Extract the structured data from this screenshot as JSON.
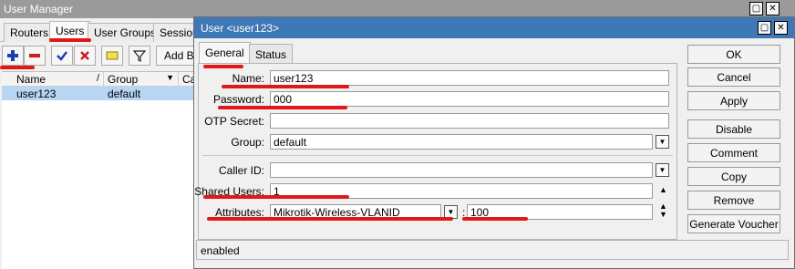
{
  "background_window": {
    "title": "User Manager",
    "tabs": [
      "Routers",
      "Users",
      "User Groups",
      "Sessions"
    ],
    "active_tab": "Users",
    "toolbar": {
      "add_button_label": "Add Ba"
    },
    "table": {
      "columns": [
        "Name",
        "Group",
        "Cal"
      ],
      "rows": [
        {
          "name": "user123",
          "group": "default"
        }
      ]
    }
  },
  "dialog": {
    "title": "User <user123>",
    "tabs": [
      "General",
      "Status"
    ],
    "active_tab": "General",
    "fields": {
      "name": {
        "label": "Name:",
        "value": "user123"
      },
      "password": {
        "label": "Password:",
        "value": "000"
      },
      "otp_secret": {
        "label": "OTP Secret:",
        "value": ""
      },
      "group": {
        "label": "Group:",
        "value": "default"
      },
      "caller_id": {
        "label": "Caller ID:",
        "value": ""
      },
      "shared_users": {
        "label": "Shared Users:",
        "value": "1"
      },
      "attributes": {
        "label": "Attributes:",
        "value": "Mikrotik-Wireless-VLANID",
        "separator": ":",
        "extra_value": "100"
      }
    },
    "buttons": {
      "ok": "OK",
      "cancel": "Cancel",
      "apply": "Apply",
      "disable": "Disable",
      "comment": "Comment",
      "copy": "Copy",
      "remove": "Remove",
      "generate_voucher": "Generate Voucher"
    },
    "status": "enabled"
  },
  "colors": {
    "dialog_titlebar": "#3e78b7",
    "selected_row": "#b7d6f3",
    "annotation_red": "#e01818",
    "add_icon": "#1f3fa8",
    "remove_icon": "#c81e1e",
    "check_icon": "#1f3fa8"
  },
  "icons": [
    "add-icon",
    "remove-icon",
    "check-icon",
    "cross-icon",
    "comment-icon",
    "filter-icon",
    "restore-icon",
    "close-icon",
    "dropdown-icon",
    "arrow-up-icon",
    "arrow-updown-icon"
  ]
}
